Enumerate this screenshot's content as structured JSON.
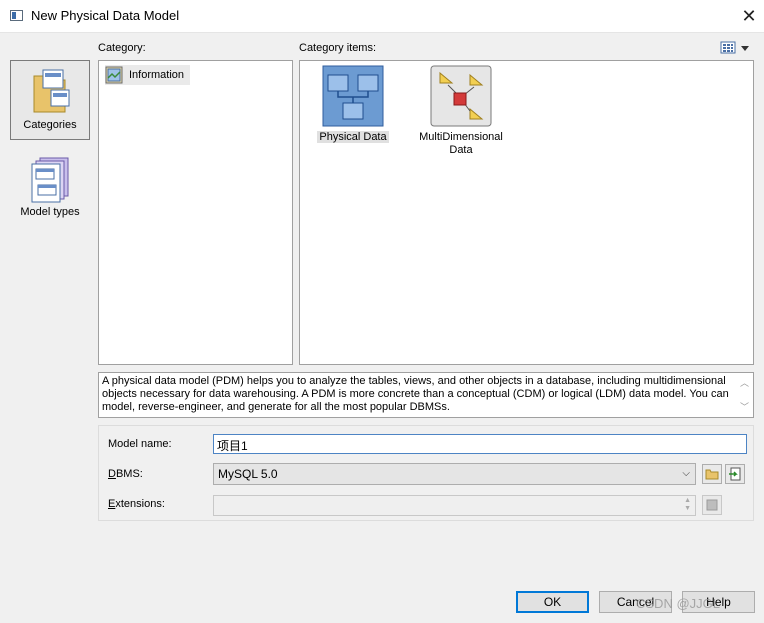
{
  "window": {
    "title": "New Physical Data Model",
    "close_glyph": "✕"
  },
  "nav": {
    "items": [
      {
        "label": "Categories",
        "icon": "categories-icon",
        "selected": true
      },
      {
        "label": "Model types",
        "icon": "model-types-icon",
        "selected": false
      }
    ]
  },
  "category": {
    "heading": "Category:",
    "items": [
      {
        "label": "Information",
        "icon": "information-icon"
      }
    ]
  },
  "category_items": {
    "heading": "Category items:",
    "view_icon": "list-view-icon",
    "items": [
      {
        "label": "Physical Data",
        "icon": "physical-data-icon",
        "selected": true
      },
      {
        "label_line1": "MultiDimensional",
        "label_line2": "Data",
        "icon": "multidimensional-data-icon",
        "selected": false
      }
    ]
  },
  "description": {
    "text": "A physical data model (PDM) helps you to analyze the tables, views, and other objects in a database, including multidimensional objects necessary for data warehousing. A PDM is more concrete than a conceptual (CDM) or logical (LDM) data model. You can model, reverse-engineer, and generate for all the most popular DBMSs."
  },
  "form": {
    "model_name_label": "Model name:",
    "model_name_value": "项目1",
    "dbms_label_first": "D",
    "dbms_label_rest": "BMS:",
    "dbms_value": "MySQL 5.0",
    "extensions_label_first": "E",
    "extensions_label_rest": "xtensions:",
    "extensions_value": ""
  },
  "buttons": {
    "ok": "OK",
    "cancel": "Cancel",
    "help": "Help"
  },
  "watermark": "CSDN @JJGL",
  "colors": {
    "focus_border": "#0078d7",
    "selection": "#e0e0e0"
  }
}
